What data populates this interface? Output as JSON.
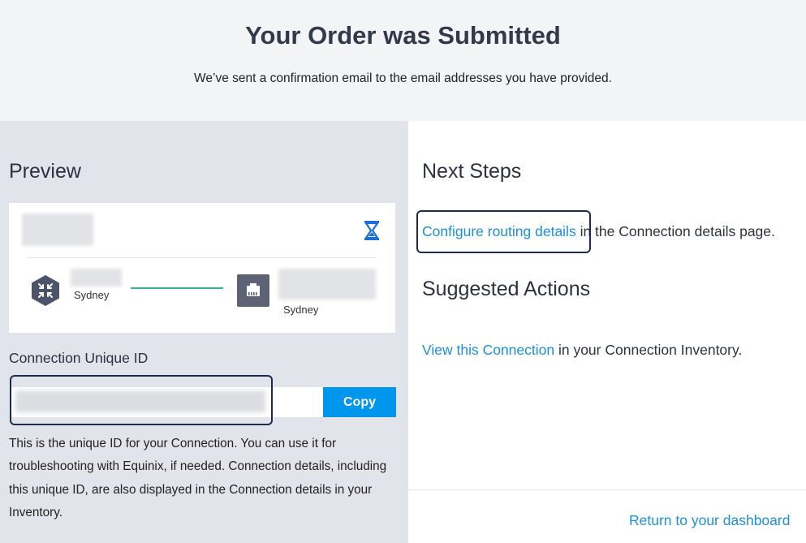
{
  "header": {
    "title": "Your Order was Submitted",
    "subtitle": "We’ve sent a confirmation email to the email addresses you have provided."
  },
  "preview": {
    "title": "Preview",
    "status_icon": "hourglass-icon",
    "source": {
      "icon": "hexagon-arrows-icon",
      "city": "Sydney"
    },
    "destination": {
      "icon": "ethernet-port-icon",
      "city": "Sydney"
    },
    "connection_line_color": "#37b59b"
  },
  "unique_id": {
    "label": "Connection Unique ID",
    "copy_label": "Copy",
    "description": "This is the unique ID for your Connection. You can use it for troubleshooting with Equinix, if needed. Connection details, including this unique ID, are also displayed in the Connection details in your Inventory."
  },
  "next_steps": {
    "title": "Next Steps",
    "link": "Configure routing details",
    "suffix": " in the Connection details page."
  },
  "suggested": {
    "title": "Suggested Actions",
    "link": "View this Connection",
    "suffix": " in your Connection Inventory."
  },
  "footer": {
    "dashboard_link": "Return to your dashboard"
  },
  "colors": {
    "accent": "#0096ee",
    "link": "#1c8fe0",
    "highlight": "#1e2c4a"
  }
}
